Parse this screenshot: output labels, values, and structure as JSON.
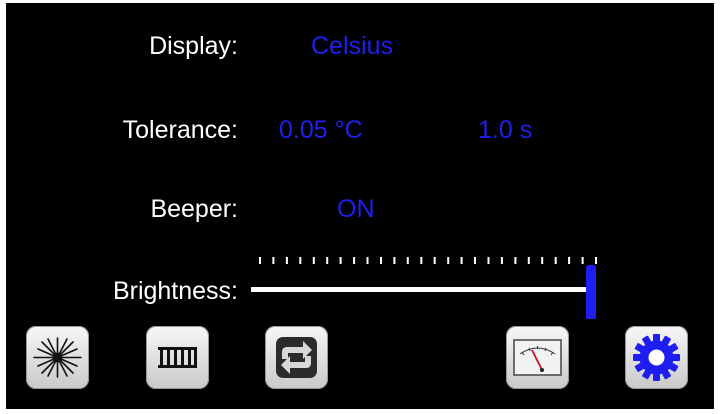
{
  "settings": {
    "display": {
      "label": "Display:",
      "value": "Celsius"
    },
    "tolerance": {
      "label": "Tolerance:",
      "temperature": "0.05 °C",
      "time": "1.0 s"
    },
    "beeper": {
      "label": "Beeper:",
      "value": "ON"
    },
    "brightness": {
      "label": "Brightness:",
      "level_fraction": 1.0,
      "tick_count": 26
    }
  },
  "toolbar": {
    "buttons": [
      {
        "name": "laser",
        "icon": "laser-burst-icon",
        "selected": false
      },
      {
        "name": "heater",
        "icon": "heater-grid-icon",
        "selected": false
      },
      {
        "name": "cycle",
        "icon": "cycle-arrows-icon",
        "selected": false
      },
      {
        "name": "meter",
        "icon": "analog-meter-icon",
        "selected": false
      },
      {
        "name": "settings",
        "icon": "gear-icon",
        "selected": true
      }
    ]
  },
  "colors": {
    "background": "#000000",
    "label": "#ffffff",
    "value_accent": "#1f1ff0"
  }
}
